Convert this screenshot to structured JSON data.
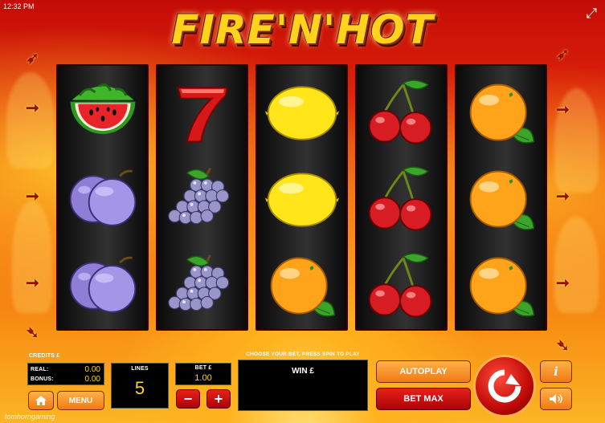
{
  "status_bar": {
    "time": "12:32 PM"
  },
  "logo_text": "FIRE'N'HOT",
  "reels": [
    [
      "watermelon",
      "plum",
      "plum"
    ],
    [
      "seven",
      "grapes",
      "grapes"
    ],
    [
      "lemon",
      "lemon",
      "orange"
    ],
    [
      "cherries",
      "cherries",
      "cherries"
    ],
    [
      "orange",
      "orange",
      "orange"
    ]
  ],
  "panel": {
    "credits_label": "CREDITS £",
    "real_label": "REAL:",
    "real_value": "0.00",
    "bonus_label": "BONUS:",
    "bonus_value": "0.00",
    "lines_label": "LINES",
    "lines_value": "5",
    "bet_label": "BET £",
    "bet_value": "1.00",
    "instruction": "CHOOSE YOUR BET, PRESS SPIN TO PLAY",
    "win_label": "WIN £",
    "menu_label": "MENU",
    "minus_label": "−",
    "plus_label": "+",
    "autoplay_label": "AUTOPLAY",
    "betmax_label": "BET MAX",
    "info_label": "i"
  },
  "watermark": "tomhorngaming",
  "colors": {
    "accent_yellow": "#ffd21d",
    "button_orange": "#f07a12",
    "button_red": "#c00a08"
  }
}
